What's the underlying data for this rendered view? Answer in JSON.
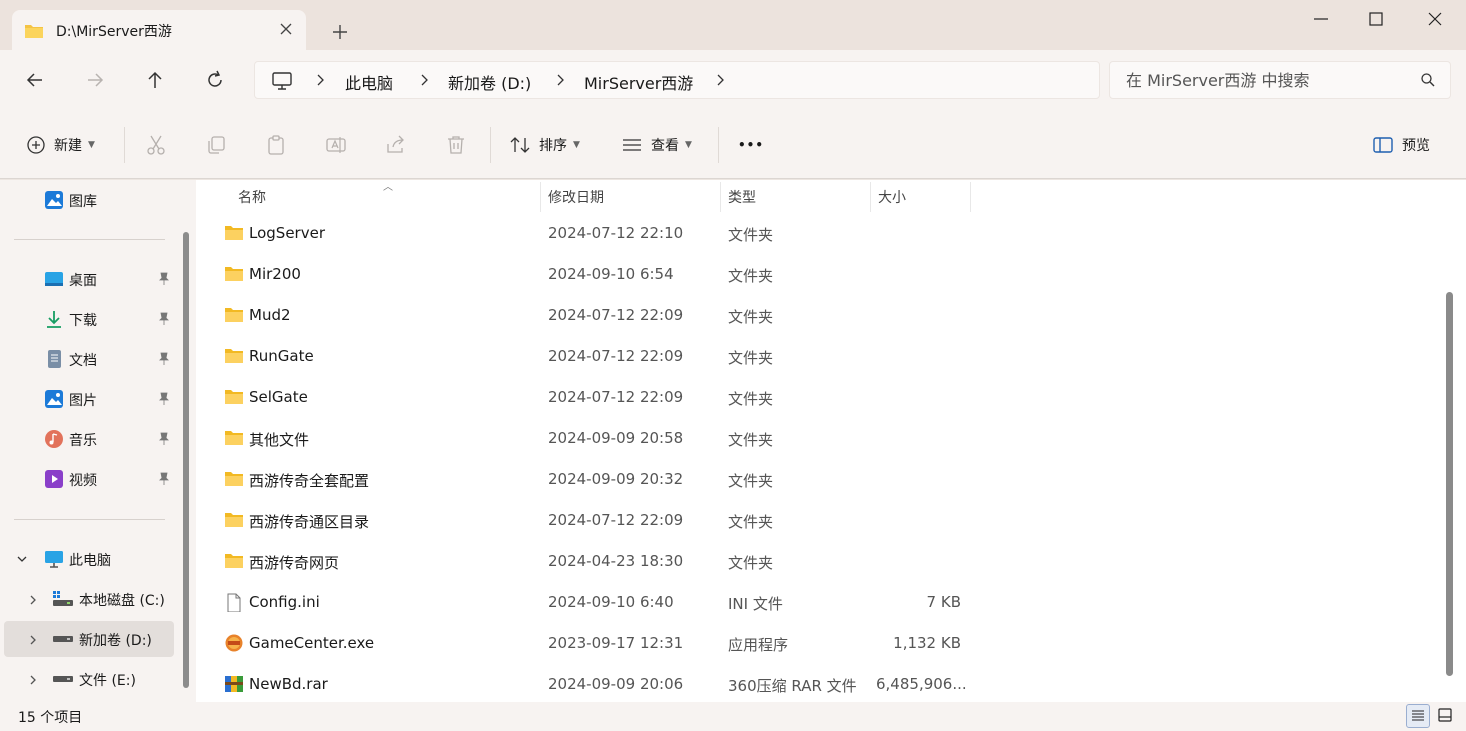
{
  "tab": {
    "title": "D:\\MirServer西游"
  },
  "breadcrumb": [
    "此电脑",
    "新加卷 (D:)",
    "MirServer西游"
  ],
  "search": {
    "placeholder": "在 MirServer西游 中搜索"
  },
  "toolbar": {
    "new_label": "新建",
    "sort_label": "排序",
    "view_label": "查看",
    "more_label": "•••",
    "preview_label": "预览"
  },
  "sidebar": {
    "gallery": "图库",
    "quick": [
      {
        "label": "桌面"
      },
      {
        "label": "下载"
      },
      {
        "label": "文档"
      },
      {
        "label": "图片"
      },
      {
        "label": "音乐"
      },
      {
        "label": "视频"
      }
    ],
    "this_pc": "此电脑",
    "drives": [
      {
        "label": "本地磁盘 (C:)"
      },
      {
        "label": "新加卷 (D:)"
      },
      {
        "label": "文件 (E:)"
      }
    ]
  },
  "columns": {
    "name": "名称",
    "date": "修改日期",
    "type": "类型",
    "size": "大小"
  },
  "files": [
    {
      "name": "LogServer",
      "date": "2024-07-12 22:10",
      "type": "文件夹",
      "size": "",
      "icon": "folder-icon"
    },
    {
      "name": "Mir200",
      "date": "2024-09-10 6:54",
      "type": "文件夹",
      "size": "",
      "icon": "folder-icon"
    },
    {
      "name": "Mud2",
      "date": "2024-07-12 22:09",
      "type": "文件夹",
      "size": "",
      "icon": "folder-icon"
    },
    {
      "name": "RunGate",
      "date": "2024-07-12 22:09",
      "type": "文件夹",
      "size": "",
      "icon": "folder-icon"
    },
    {
      "name": "SelGate",
      "date": "2024-07-12 22:09",
      "type": "文件夹",
      "size": "",
      "icon": "folder-icon"
    },
    {
      "name": "其他文件",
      "date": "2024-09-09 20:58",
      "type": "文件夹",
      "size": "",
      "icon": "folder-icon"
    },
    {
      "name": "西游传奇全套配置",
      "date": "2024-09-09 20:32",
      "type": "文件夹",
      "size": "",
      "icon": "folder-icon"
    },
    {
      "name": "西游传奇通区目录",
      "date": "2024-07-12 22:09",
      "type": "文件夹",
      "size": "",
      "icon": "folder-icon"
    },
    {
      "name": "西游传奇网页",
      "date": "2024-04-23 18:30",
      "type": "文件夹",
      "size": "",
      "icon": "folder-icon"
    },
    {
      "name": "Config.ini",
      "date": "2024-09-10 6:40",
      "type": "INI 文件",
      "size": "7 KB",
      "icon": "ini-file-icon"
    },
    {
      "name": "GameCenter.exe",
      "date": "2023-09-17 12:31",
      "type": "应用程序",
      "size": "1,132 KB",
      "icon": "exe-file-icon"
    },
    {
      "name": "NewBd.rar",
      "date": "2024-09-09 20:06",
      "type": "360压缩 RAR 文件",
      "size": "6,485,906...",
      "icon": "rar-file-icon"
    }
  ],
  "status": {
    "count": "15 个项目"
  }
}
